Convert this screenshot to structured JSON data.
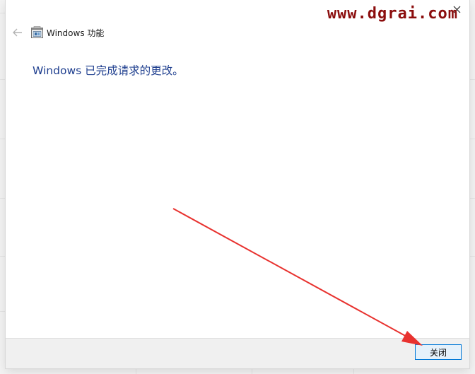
{
  "dialog": {
    "title": "Windows 功能",
    "message": "Windows 已完成请求的更改。",
    "close_button_label": "关闭"
  },
  "icons": {
    "back": "arrow-left-icon",
    "app": "windows-features-icon",
    "close": "close-icon"
  },
  "watermark": "www.dgrai.com",
  "colors": {
    "message": "#1f3f8f",
    "button_border": "#0078d7",
    "button_fill": "#e5f1fb",
    "watermark": "#8b0d0d",
    "arrow": "#e8322f"
  }
}
